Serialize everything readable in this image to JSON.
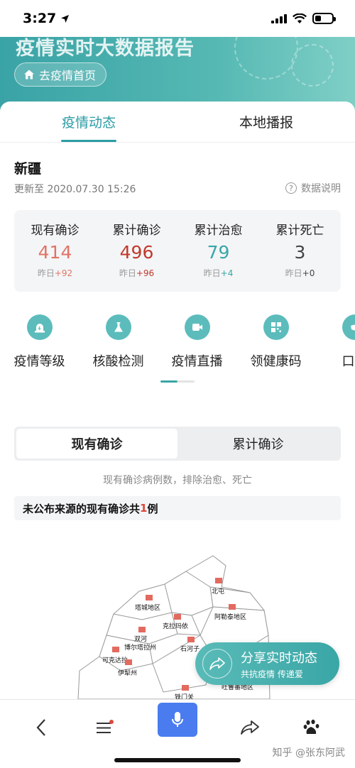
{
  "status": {
    "time": "3:27"
  },
  "header": {
    "title": "疫情实时大数据报告",
    "home_button": "去疫情首页"
  },
  "tabs": [
    {
      "label": "疫情动态",
      "active": true
    },
    {
      "label": "本地播报",
      "active": false
    }
  ],
  "region": {
    "name": "新疆",
    "updated": "更新至 2020.07.30 15:26",
    "explain": "数据说明"
  },
  "stats": [
    {
      "label": "现有确诊",
      "value": "414",
      "delta_label": "昨日",
      "delta": "+92",
      "color": "#e07366"
    },
    {
      "label": "累计确诊",
      "value": "496",
      "delta_label": "昨日",
      "delta": "+96",
      "color": "#c0392b"
    },
    {
      "label": "累计治愈",
      "value": "79",
      "delta_label": "昨日",
      "delta": "+4",
      "color": "#3aa6a6"
    },
    {
      "label": "累计死亡",
      "value": "3",
      "delta_label": "昨日",
      "delta": "+0",
      "color": "#444444"
    }
  ],
  "services": [
    {
      "label": "疫情等级",
      "icon": "alarm-icon"
    },
    {
      "label": "核酸检测",
      "icon": "flask-icon"
    },
    {
      "label": "疫情直播",
      "icon": "video-icon"
    },
    {
      "label": "领健康码",
      "icon": "qr-code-icon"
    },
    {
      "label": "口罩",
      "icon": "mask-icon"
    }
  ],
  "segment": {
    "options": [
      "现有确诊",
      "累计确诊"
    ],
    "selected": "现有确诊"
  },
  "note": "现有确诊病例数，排除治愈、死亡",
  "unsourced": {
    "prefix": "未公布来源的现有确诊共",
    "count": "1",
    "suffix": "例"
  },
  "map_labels": [
    "北屯",
    "塔城地区",
    "阿勒泰地区",
    "克拉玛依",
    "双河",
    "博尔塔拉州",
    "石河子",
    "可克达拉",
    "伊犁州",
    "吐鲁番地区",
    "铁门关"
  ],
  "share": {
    "title": "分享实时动态",
    "subtitle": "共抗疫情 传递爱"
  },
  "watermark": "知乎 @张东阿武",
  "colors": {
    "accent": "#2b9ca4",
    "mic": "#4a7cf0"
  }
}
